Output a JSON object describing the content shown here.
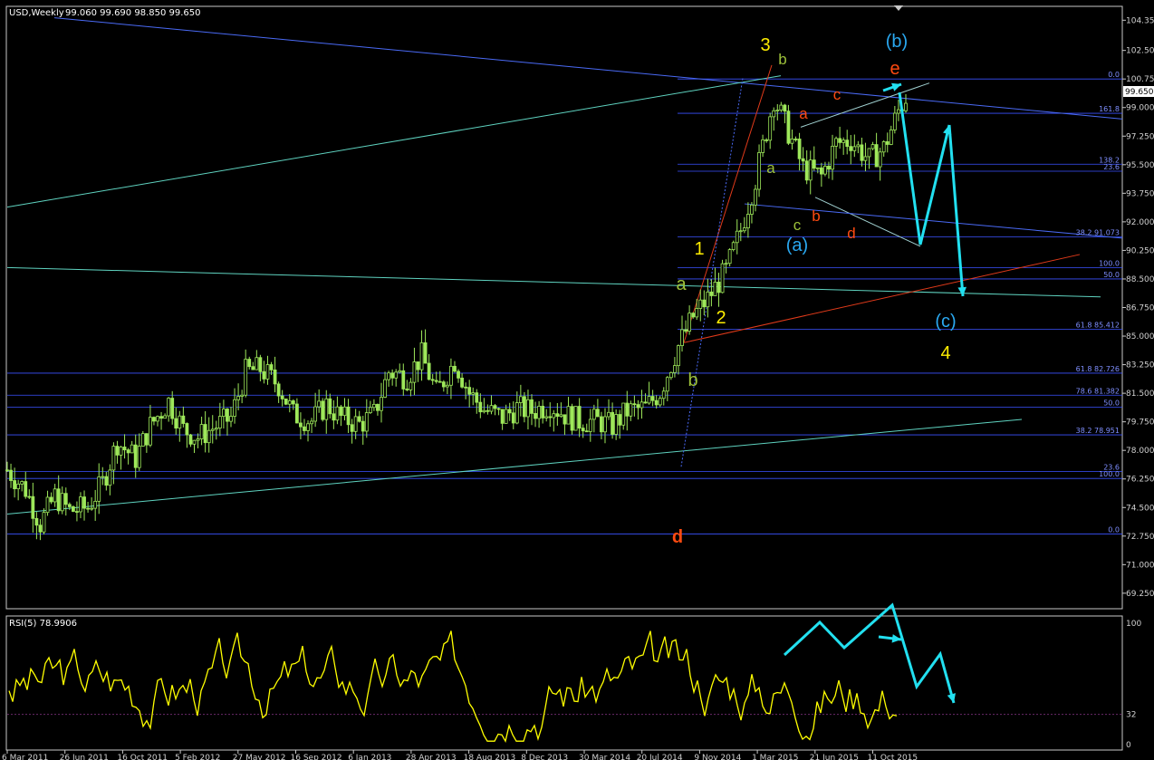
{
  "header": {
    "symbol": "USD,Weekly",
    "ohlc": "99.060 99.690 98.850 99.650"
  },
  "rsi_header": "RSI(5) 78.9906",
  "current_price": "99.650",
  "colors": {
    "background": "#000000",
    "frame": "#c8c8c8",
    "candle": "#9ee85a",
    "fib_line": "#3a52ff",
    "channel_line": "#4a6af5",
    "trend_line": "#5fd3c0",
    "red_line": "#e03a1a",
    "rsi_line": "#ffff00",
    "cyan_arrow": "#22e0f0",
    "label_yellow": "#ffee00",
    "label_green": "#9ec23a",
    "label_red": "#ff4a10",
    "label_blue": "#2aa8f0"
  },
  "chart_data": [
    {
      "type": "candlestick",
      "title": "",
      "ylim": [
        68.3,
        105.2
      ],
      "y_ticks": [
        "104.350",
        "102.500",
        "100.750",
        "99.000",
        "97.250",
        "95.500",
        "93.750",
        "92.000",
        "90.250",
        "88.500",
        "86.750",
        "85.000",
        "83.250",
        "81.500",
        "79.750",
        "78.000",
        "76.250",
        "74.500",
        "72.750",
        "71.000",
        "69.250"
      ],
      "x_ticks": [
        "6 Mar 2011",
        "26 Jun 2011",
        "16 Oct 2011",
        "5 Feb 2012",
        "27 May 2012",
        "16 Sep 2012",
        "6 Jan 2013",
        "28 Apr 2013",
        "18 Aug 2013",
        "8 Dec 2013",
        "30 Mar 2014",
        "20 Jul 2014",
        "9 Nov 2014",
        "1 Mar 2015",
        "21 Jun 2015",
        "11 Oct 2015"
      ],
      "x_range": [
        "2011-03-06",
        "2015-11-15"
      ],
      "close_path": [
        [
          "2011-03-06",
          76.8
        ],
        [
          "2011-04-10",
          75.6
        ],
        [
          "2011-05-08",
          73.5
        ],
        [
          "2011-06-05",
          75.2
        ],
        [
          "2011-07-03",
          74.3
        ],
        [
          "2011-08-07",
          74.5
        ],
        [
          "2011-09-04",
          76.0
        ],
        [
          "2011-10-02",
          78.5
        ],
        [
          "2011-11-06",
          77.5
        ],
        [
          "2011-12-04",
          79.5
        ],
        [
          "2012-01-08",
          81.0
        ],
        [
          "2012-02-05",
          79.3
        ],
        [
          "2012-03-04",
          78.8
        ],
        [
          "2012-04-08",
          79.5
        ],
        [
          "2012-05-06",
          80.0
        ],
        [
          "2012-06-03",
          82.8
        ],
        [
          "2012-07-01",
          83.0
        ],
        [
          "2012-08-05",
          82.0
        ],
        [
          "2012-09-02",
          80.2
        ],
        [
          "2012-10-07",
          79.8
        ],
        [
          "2012-11-04",
          80.8
        ],
        [
          "2012-12-02",
          80.0
        ],
        [
          "2013-01-06",
          79.6
        ],
        [
          "2013-02-03",
          80.2
        ],
        [
          "2013-03-03",
          82.8
        ],
        [
          "2013-04-07",
          82.5
        ],
        [
          "2013-05-05",
          83.8
        ],
        [
          "2013-06-02",
          81.5
        ],
        [
          "2013-07-07",
          83.5
        ],
        [
          "2013-08-04",
          81.5
        ],
        [
          "2013-09-01",
          80.5
        ],
        [
          "2013-10-06",
          80.0
        ],
        [
          "2013-11-03",
          80.6
        ],
        [
          "2013-12-01",
          80.4
        ],
        [
          "2014-01-05",
          80.8
        ],
        [
          "2014-02-02",
          80.2
        ],
        [
          "2014-03-02",
          79.8
        ],
        [
          "2014-04-06",
          79.8
        ],
        [
          "2014-05-04",
          79.5
        ],
        [
          "2014-06-01",
          80.4
        ],
        [
          "2014-07-06",
          80.6
        ],
        [
          "2014-08-03",
          81.6
        ],
        [
          "2014-09-07",
          84.4
        ],
        [
          "2014-10-05",
          86.2
        ],
        [
          "2014-11-02",
          87.3
        ],
        [
          "2014-12-07",
          89.0
        ],
        [
          "2015-01-04",
          91.5
        ],
        [
          "2015-02-01",
          94.6
        ],
        [
          "2015-03-08",
          99.6
        ],
        [
          "2015-04-05",
          97.5
        ],
        [
          "2015-05-03",
          95.3
        ],
        [
          "2015-06-07",
          94.8
        ],
        [
          "2015-07-05",
          96.8
        ],
        [
          "2015-08-02",
          97.0
        ],
        [
          "2015-09-06",
          95.8
        ],
        [
          "2015-10-04",
          96.5
        ],
        [
          "2015-11-01",
          98.8
        ],
        [
          "2015-11-15",
          99.65
        ]
      ],
      "fib_levels_left": [
        {
          "label": "0.0",
          "value": 100.75
        },
        {
          "label": "161.8",
          "value": 98.65
        },
        {
          "label": "138.2",
          "value": 95.53
        },
        {
          "label": "23.6",
          "value": 95.1
        },
        {
          "label": "38.2 91.073",
          "value": 91.07
        },
        {
          "label": "100.0",
          "value": 89.2
        },
        {
          "label": "50.0",
          "value": 88.5
        },
        {
          "label": "61.8 85.412",
          "value": 85.41
        }
      ],
      "fib_levels_right": [
        {
          "label": "61.8 82.726",
          "value": 82.73
        },
        {
          "label": "78.6 81.382",
          "value": 81.38
        },
        {
          "label": "50.0",
          "value": 80.64
        },
        {
          "label": "38.2 78.951",
          "value": 78.95
        },
        {
          "label": "23.6",
          "value": 76.7
        },
        {
          "label": "100.0",
          "value": 76.28
        },
        {
          "label": "0.0",
          "value": 72.88
        }
      ],
      "wave_labels": [
        {
          "text": "3",
          "color": "label_yellow"
        },
        {
          "text": "b",
          "color": "label_green"
        },
        {
          "text": "(b)",
          "color": "label_blue"
        },
        {
          "text": "e",
          "color": "label_red"
        },
        {
          "text": "a",
          "color": "label_red"
        },
        {
          "text": "c",
          "color": "label_red"
        },
        {
          "text": "a",
          "color": "label_green"
        },
        {
          "text": "c",
          "color": "label_green"
        },
        {
          "text": "b",
          "color": "label_red"
        },
        {
          "text": "d",
          "color": "label_red"
        },
        {
          "text": "(a)",
          "color": "label_blue"
        },
        {
          "text": "1",
          "color": "label_yellow"
        },
        {
          "text": "a",
          "color": "label_green"
        },
        {
          "text": "2",
          "color": "label_yellow"
        },
        {
          "text": "b",
          "color": "label_green"
        },
        {
          "text": "(c)",
          "color": "label_blue"
        },
        {
          "text": "4",
          "color": "label_yellow"
        },
        {
          "text": "d",
          "color": "label_red"
        }
      ]
    },
    {
      "type": "line",
      "title": "",
      "series": [
        {
          "name": "RSI(5)",
          "last": 78.9906
        }
      ],
      "ylim": [
        0,
        100
      ],
      "y_ticks": [
        "100",
        "32",
        "0"
      ],
      "levels": [
        32
      ]
    }
  ]
}
